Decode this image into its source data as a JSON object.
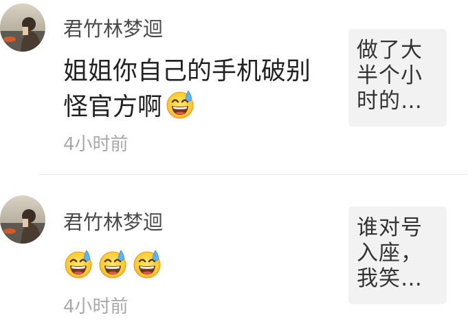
{
  "comments": [
    {
      "username": "君竹林梦迴",
      "message": "姐姐你自己的手机破别怪官方啊",
      "emoji": [
        "grinning-sweat"
      ],
      "time": "4小时前",
      "thumb_text": "做了大半个小时的…"
    },
    {
      "username": "君竹林梦迴",
      "message": "",
      "emoji": [
        "grinning-sweat",
        "grinning-sweat",
        "grinning-sweat"
      ],
      "time": "4小时前",
      "thumb_text": "谁对号入座，我笑…"
    }
  ],
  "colors": {
    "username": "#4a4a4a",
    "message": "#222222",
    "time": "#a8a8a8",
    "thumb_bg": "#f2f2f2",
    "divider": "#e8e8e8"
  }
}
